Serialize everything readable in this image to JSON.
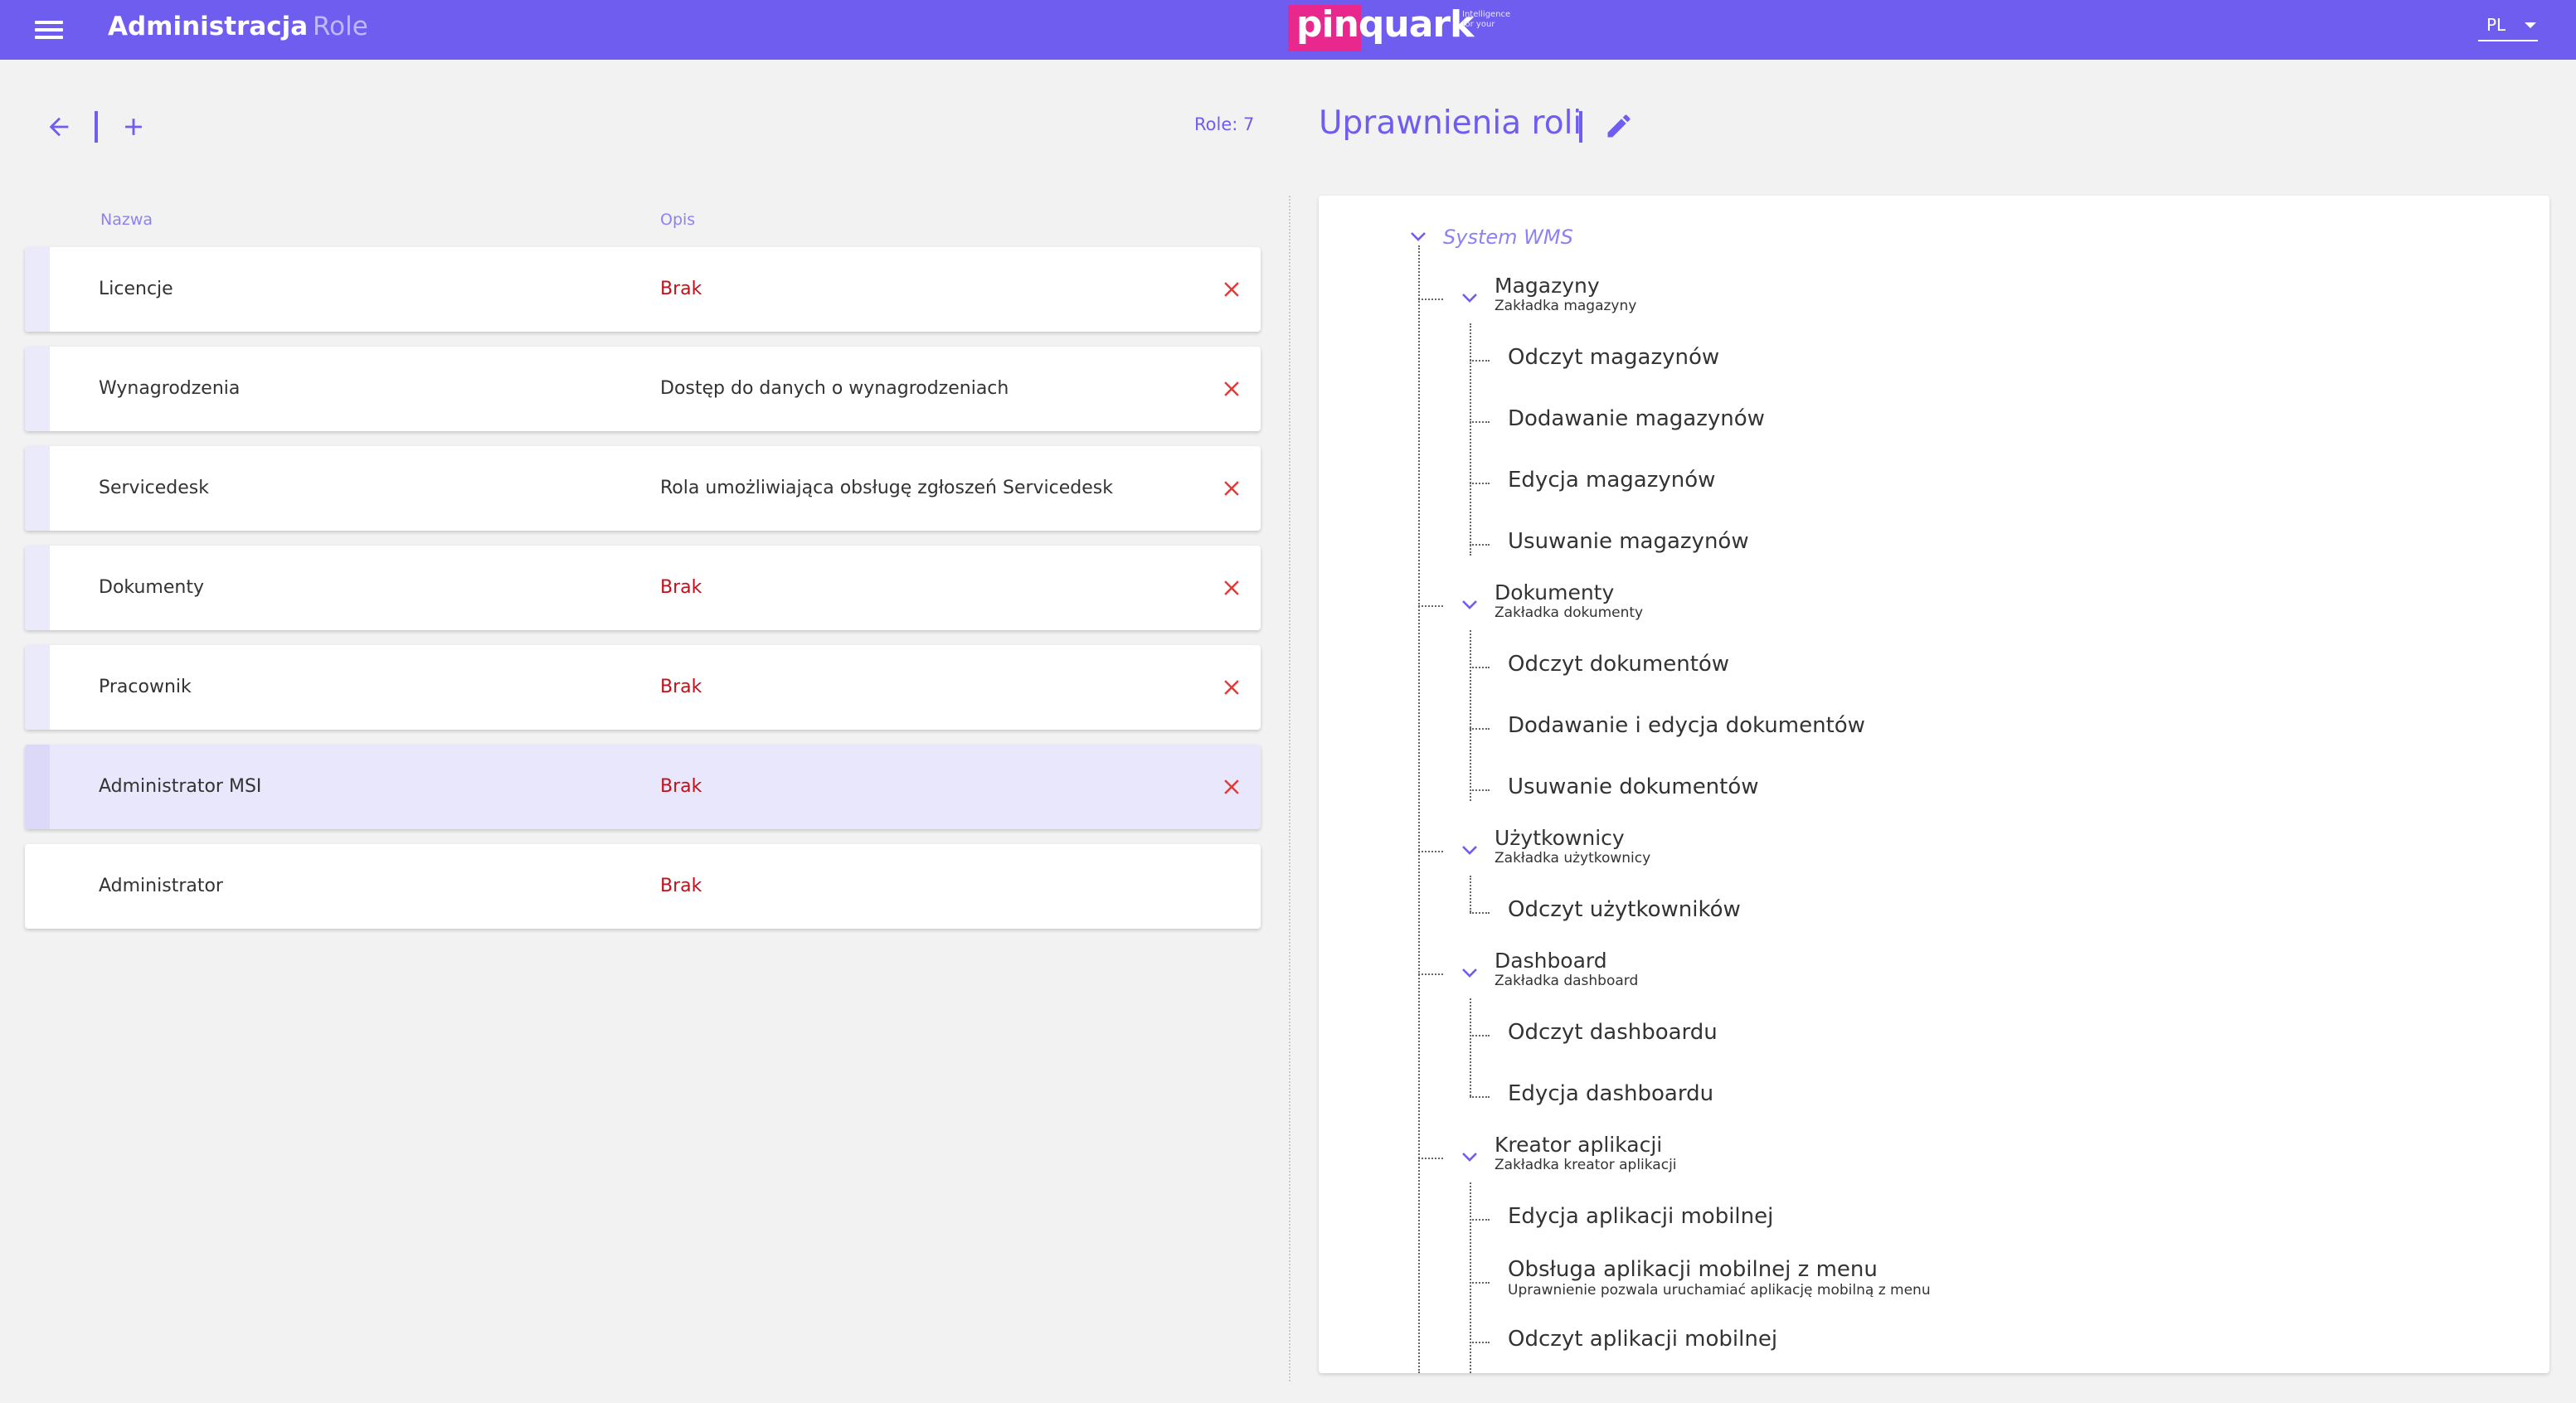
{
  "header": {
    "title": "Administracja",
    "breadcrumb": "Role",
    "language": "PL"
  },
  "logo": {
    "text": "pinquark",
    "tagline": "Intelligence for your"
  },
  "roles_panel": {
    "count_text": "Role: 7",
    "columns": [
      "Nazwa",
      "Opis"
    ],
    "rows": [
      {
        "name": "Licencje",
        "description": "Brak"
      },
      {
        "name": "Wynagrodzenia",
        "description": "Dostęp do danych o wynagrodzeniach"
      },
      {
        "name": "Servicedesk",
        "description": "Rola umożliwiająca obsługę zgłoszeń Servicedesk"
      },
      {
        "name": "Dokumenty",
        "description": "Brak"
      },
      {
        "name": "Pracownik",
        "description": "Brak"
      },
      {
        "name": "Administrator MSI",
        "description": "Brak"
      },
      {
        "name": "Administrator",
        "description": "Brak"
      }
    ],
    "selected_role": "Administrator MSI"
  },
  "permissions": {
    "title": "Uprawnienia roli",
    "root": "System WMS",
    "groups": [
      {
        "label": "Magazyny",
        "sub": "Zakładka magazyny",
        "items": [
          {
            "label": "Odczyt magazynów"
          },
          {
            "label": "Dodawanie magazynów"
          },
          {
            "label": "Edycja magazynów"
          },
          {
            "label": "Usuwanie magazynów"
          }
        ]
      },
      {
        "label": "Dokumenty",
        "sub": "Zakładka dokumenty",
        "items": [
          {
            "label": "Odczyt dokumentów"
          },
          {
            "label": "Dodawanie i edycja dokumentów"
          },
          {
            "label": "Usuwanie dokumentów"
          }
        ]
      },
      {
        "label": "Użytkownicy",
        "sub": "Zakładka użytkownicy",
        "items": [
          {
            "label": "Odczyt użytkowników"
          }
        ]
      },
      {
        "label": "Dashboard",
        "sub": "Zakładka dashboard",
        "items": [
          {
            "label": "Odczyt dashboardu"
          },
          {
            "label": "Edycja dashboardu"
          }
        ]
      },
      {
        "label": "Kreator aplikacji",
        "sub": "Zakładka kreator aplikacji",
        "items": [
          {
            "label": "Edycja aplikacji mobilnej"
          },
          {
            "label": "Obsługa aplikacji mobilnej z menu",
            "sub": "Uprawnienie pozwala uruchamiać aplikację mobilną z menu"
          },
          {
            "label": "Odczyt aplikacji mobilnej"
          }
        ]
      }
    ]
  },
  "colors": {
    "primary": "#6f5df0",
    "brand_pink": "#e8288c",
    "danger": "#e53935",
    "error_text": "#c0111a"
  },
  "icons": {
    "menu": "menu-icon",
    "back": "arrow-left-icon",
    "add": "plus-icon",
    "delete": "close-icon",
    "edit": "pencil-icon",
    "expand": "chevron-down-icon",
    "lang": "caret-down-icon"
  }
}
